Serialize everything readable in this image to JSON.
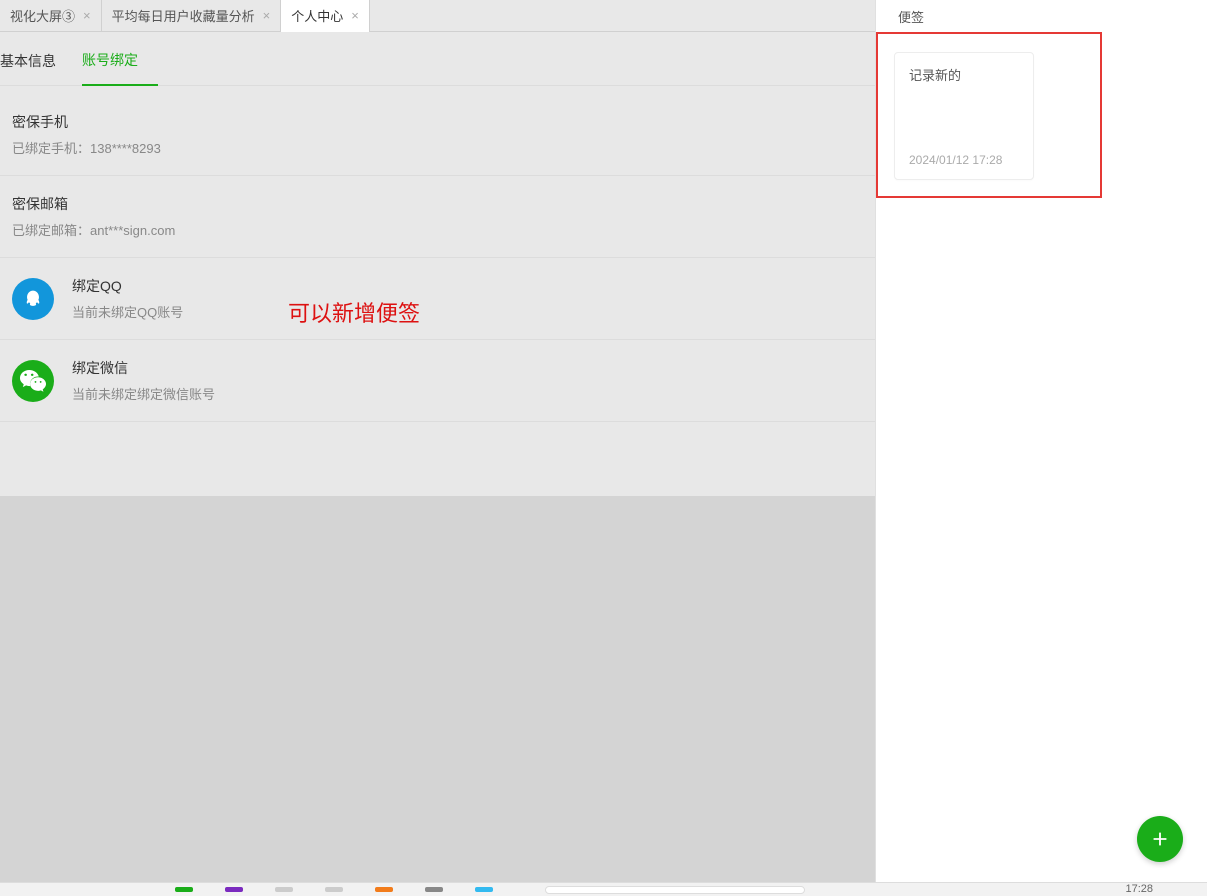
{
  "tabs": [
    {
      "label": "视化大屏③",
      "active": false
    },
    {
      "label": "平均每日用户收藏量分析",
      "active": false
    },
    {
      "label": "个人中心",
      "active": true
    }
  ],
  "sub_tabs": [
    {
      "label": "基本信息",
      "active": false
    },
    {
      "label": "账号绑定",
      "active": true
    }
  ],
  "bindings": {
    "phone": {
      "title": "密保手机",
      "desc": "已绑定手机：138****8293"
    },
    "email": {
      "title": "密保邮箱",
      "desc": "已绑定邮箱：ant***sign.com"
    },
    "qq": {
      "title": "绑定QQ",
      "desc": "当前未绑定QQ账号"
    },
    "wechat": {
      "title": "绑定微信",
      "desc": "当前未绑定绑定微信账号"
    }
  },
  "annotation": "可以新增便签",
  "sidebar": {
    "title": "便签",
    "note": {
      "text": "记录新的",
      "time": "2024/01/12 17:28"
    }
  },
  "taskbar": {
    "time": "17:28"
  }
}
